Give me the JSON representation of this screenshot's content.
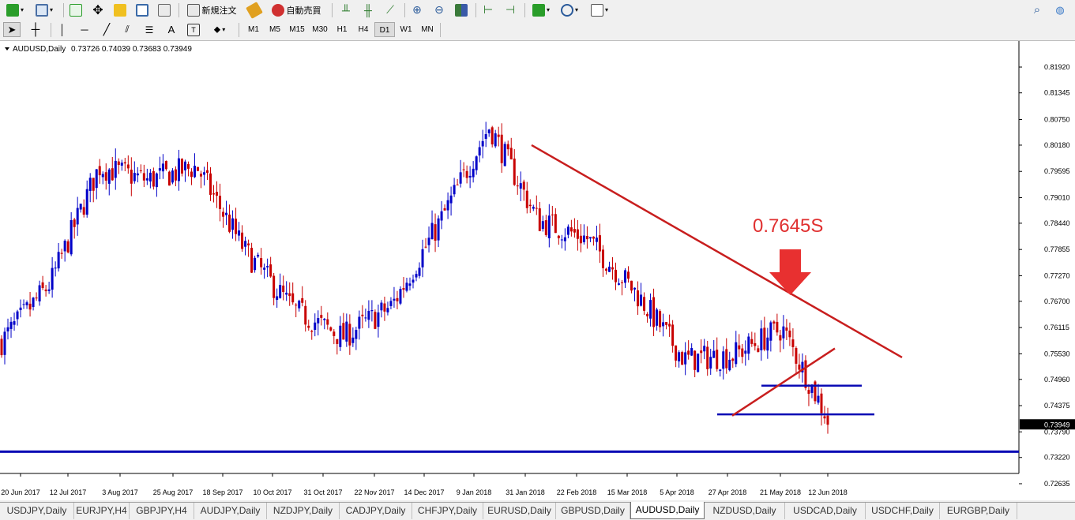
{
  "toolbar": {
    "new_order_label": "新規注文",
    "auto_trading_label": "自動売買",
    "timeframes": [
      "M1",
      "M5",
      "M15",
      "M30",
      "H1",
      "H4",
      "D1",
      "W1",
      "MN"
    ],
    "active_timeframe": "D1"
  },
  "chart": {
    "symbol_header": "AUDUSD,Daily",
    "ohlc": "0.73726 0.74039 0.73683 0.73949",
    "annotation_text": "0.7645S",
    "current_price_label": "0.73949",
    "price_axis": [
      "0.81920",
      "0.81345",
      "0.80750",
      "0.80180",
      "0.79595",
      "0.79010",
      "0.78440",
      "0.77855",
      "0.77270",
      "0.76700",
      "0.76115",
      "0.75530",
      "0.74960",
      "0.74375",
      "0.73790",
      "0.73220",
      "0.72635"
    ],
    "date_axis": [
      "20 Jun 2017",
      "12 Jul 2017",
      "3 Aug 2017",
      "25 Aug 2017",
      "18 Sep 2017",
      "10 Oct 2017",
      "31 Oct 2017",
      "22 Nov 2017",
      "14 Dec 2017",
      "9 Jan 2018",
      "31 Jan 2018",
      "22 Feb 2018",
      "15 Mar 2018",
      "5 Apr 2018",
      "27 Apr 2018",
      "21 May 2018",
      "12 Jun 2018"
    ],
    "colors": {
      "bull": "#0000c8",
      "bear": "#c80000",
      "trendline": "#c81e1e",
      "hline": "#0a0ab4",
      "annotation": "#e03030"
    }
  },
  "chart_data": {
    "type": "candlestick",
    "symbol": "AUDUSD",
    "timeframe": "Daily",
    "ylim": [
      0.72635,
      0.8192
    ],
    "last_close": 0.73949,
    "annotation": "0.7645S",
    "approx_closes": [
      {
        "date": "20 Jun 2017",
        "close": 0.758
      },
      {
        "date": "12 Jul 2017",
        "close": 0.771
      },
      {
        "date": "3 Aug 2017",
        "close": 0.797
      },
      {
        "date": "25 Aug 2017",
        "close": 0.794
      },
      {
        "date": "18 Sep 2017",
        "close": 0.797
      },
      {
        "date": "10 Oct 2017",
        "close": 0.778
      },
      {
        "date": "31 Oct 2017",
        "close": 0.765
      },
      {
        "date": "22 Nov 2017",
        "close": 0.759
      },
      {
        "date": "14 Dec 2017",
        "close": 0.766
      },
      {
        "date": "9 Jan 2018",
        "close": 0.785
      },
      {
        "date": "31 Jan 2018",
        "close": 0.806
      },
      {
        "date": "22 Feb 2018",
        "close": 0.785
      },
      {
        "date": "15 Mar 2018",
        "close": 0.781
      },
      {
        "date": "5 Apr 2018",
        "close": 0.769
      },
      {
        "date": "27 Apr 2018",
        "close": 0.754
      },
      {
        "date": "21 May 2018",
        "close": 0.755
      },
      {
        "date": "12 Jun 2018",
        "close": 0.761
      },
      {
        "date": "",
        "close": 0.7395
      }
    ],
    "horizontal_lines": [
      0.7335,
      0.7418,
      0.7482
    ],
    "trendlines": [
      {
        "from": {
          "date": "31 Jan 2018",
          "price": 0.8018
        },
        "to": {
          "date": "",
          "price": 0.7545
        }
      },
      {
        "from": {
          "date": "27 Apr 2018",
          "price": 0.7415
        },
        "to": {
          "date": "",
          "price": 0.7565
        }
      }
    ]
  },
  "tabs": [
    "USDJPY,Daily",
    "EURJPY,H4",
    "GBPJPY,H4",
    "AUDJPY,Daily",
    "NZDJPY,Daily",
    "CADJPY,Daily",
    "CHFJPY,Daily",
    "EURUSD,Daily",
    "GBPUSD,Daily",
    "AUDUSD,Daily",
    "NZDUSD,Daily",
    "USDCAD,Daily",
    "USDCHF,Daily",
    "EURGBP,Daily"
  ],
  "active_tab": "AUDUSD,Daily"
}
